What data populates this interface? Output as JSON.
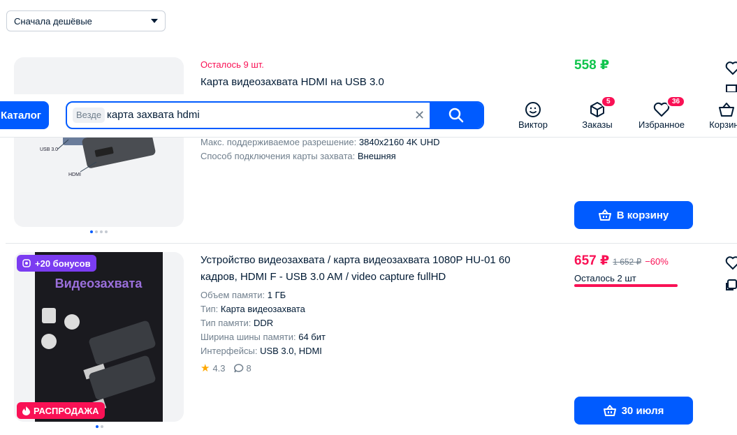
{
  "sort": {
    "label": "Сначала дешёвые"
  },
  "header": {
    "catalog_label": "Каталог",
    "search_scope": "Везде",
    "search_query": "карта захвата hdmi",
    "nav": [
      {
        "label": "Виктор",
        "icon": "profile-icon"
      },
      {
        "label": "Заказы",
        "icon": "box-icon",
        "badge": "5"
      },
      {
        "label": "Избранное",
        "icon": "heart-icon",
        "badge": "36"
      },
      {
        "label": "Корзина",
        "icon": "basket-icon"
      }
    ]
  },
  "products": [
    {
      "stock_note": "Осталось 9 шт.",
      "title": "Карта видеозахвата HDMI на USB 3.0",
      "price": "558 ₽",
      "image_labels": [
        "USB 3.0",
        "HDMI"
      ],
      "props": [
        {
          "k": "Макс. поддерживаемое разрешение:",
          "v": "3840x2160 4K UHD"
        },
        {
          "k": "Способ подключения карты захвата:",
          "v": "Внешняя"
        }
      ],
      "button": "В корзину"
    },
    {
      "bonus_badge": "+20 бонусов",
      "sale_badge": "РАСПРОДАЖА",
      "image_title": "Видеозахвата",
      "title_line1": "Устройство видеозахвата / карта видеозахвата 1080P HU-01 60",
      "title_line2": "кадров, HDMI F - USB 3.0 AM / video capture fullHD",
      "price": "657 ₽",
      "old_price": "1 652 ₽",
      "discount": "−60%",
      "stock_note": "Осталось 2 шт",
      "props": [
        {
          "k": "Объем памяти:",
          "v": "1 ГБ"
        },
        {
          "k": "Тип:",
          "v": "Карта видеозахвата"
        },
        {
          "k": "Тип памяти:",
          "v": "DDR"
        },
        {
          "k": "Ширина шины памяти:",
          "v": "64 бит"
        },
        {
          "k": "Интерфейсы:",
          "v": "USB 3.0, HDMI"
        }
      ],
      "rating": "4.3",
      "reviews": "8",
      "button": "30 июля"
    }
  ],
  "colors": {
    "accent": "#005bff",
    "price_green": "#10c44c",
    "sale": "#f91155",
    "bonus": "#7b3cf1"
  }
}
